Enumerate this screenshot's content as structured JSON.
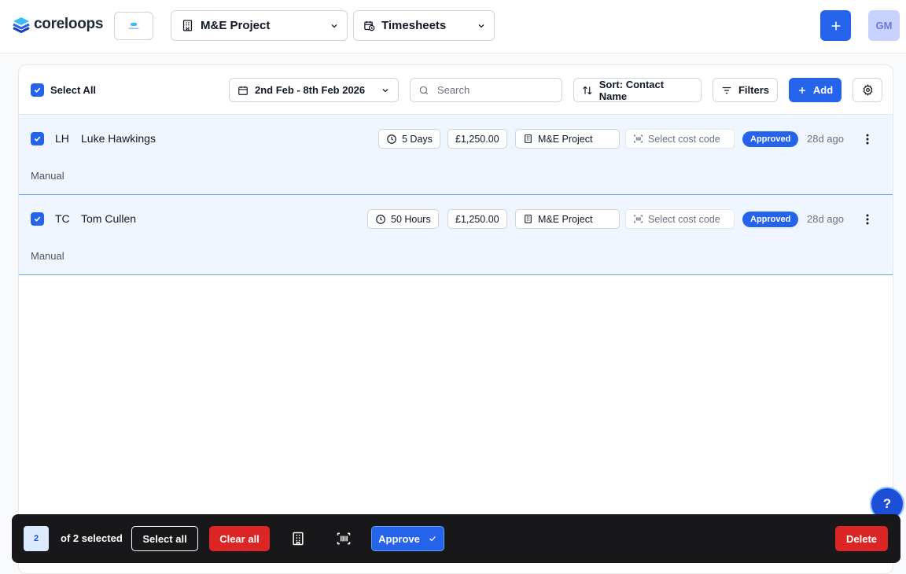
{
  "header": {
    "logo_text": "coreloops",
    "project_select": "M&E Project",
    "module_select": "Timesheets",
    "avatar_initials": "GM",
    "brand_color": "#2563eb"
  },
  "toolbar": {
    "select_all_label": "Select All",
    "date_range": "2nd Feb - 8th Feb 2026",
    "search_placeholder": "Search",
    "sort_label": "Sort: Contact Name",
    "filters_label": "Filters",
    "add_label": "Add"
  },
  "rows": [
    {
      "initials": "LH",
      "name": "Luke Hawkings",
      "duration": "5 Days",
      "amount": "£1,250.00",
      "project": "M&E Project",
      "cost_code_placeholder": "Select cost code",
      "status": "Approved",
      "age": "28d ago",
      "source": "Manual",
      "selected": true
    },
    {
      "initials": "TC",
      "name": "Tom Cullen",
      "duration": "50 Hours",
      "amount": "£1,250.00",
      "project": "M&E Project",
      "cost_code_placeholder": "Select cost code",
      "status": "Approved",
      "age": "28d ago",
      "source": "Manual",
      "selected": true
    }
  ],
  "help_label": "?",
  "bulk_bar": {
    "count": "2",
    "of_selected": "of 2 selected",
    "select_all": "Select all",
    "clear_all": "Clear all",
    "approve": "Approve",
    "delete": "Delete"
  }
}
